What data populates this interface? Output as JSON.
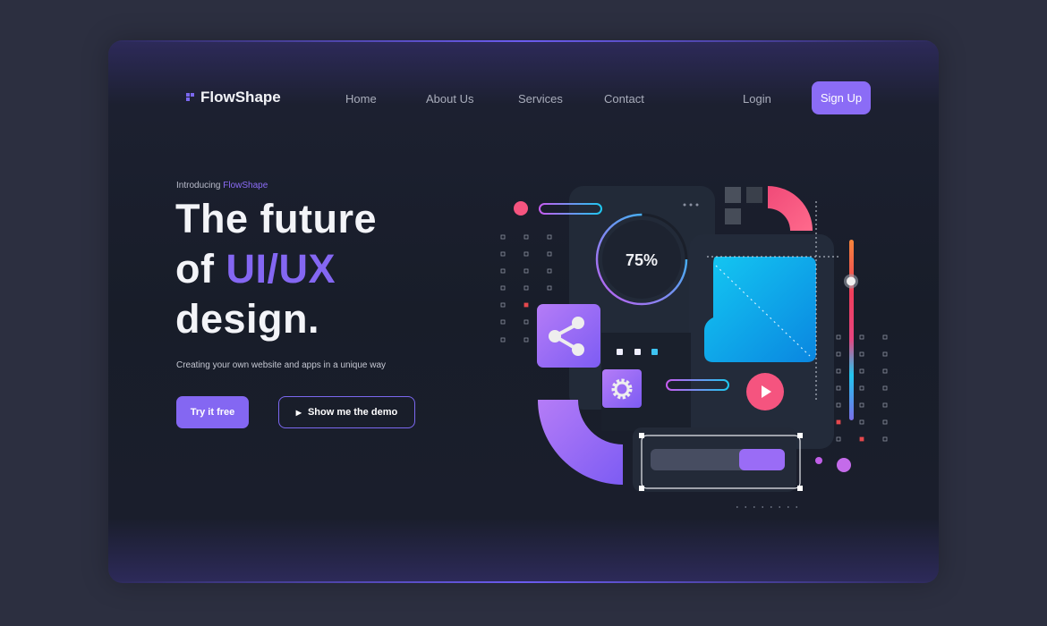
{
  "brand": {
    "name": "FlowShape"
  },
  "nav": {
    "items": [
      "Home",
      "About Us",
      "Services",
      "Contact"
    ],
    "login": "Login",
    "signup": "Sign Up"
  },
  "hero": {
    "intro_prefix": "Introducing",
    "intro_brand": "FlowShape",
    "title_line1": "The future",
    "title_line2_prefix": "of",
    "title_line2_accent": "UI/UX",
    "title_line3": "design.",
    "subtitle": "Creating your own website and apps in a unique way",
    "primary_cta": "Try it free",
    "secondary_cta": "Show me the demo"
  },
  "illustration": {
    "progress_ring_label": "75%",
    "progress_ring_value": 75,
    "progress_bar_value": 0.34,
    "slider_value": 0.77
  },
  "colors": {
    "accent": "#8467f2",
    "pink": "#f5547f",
    "cyan": "#19c3f0",
    "background": "#181d29"
  }
}
